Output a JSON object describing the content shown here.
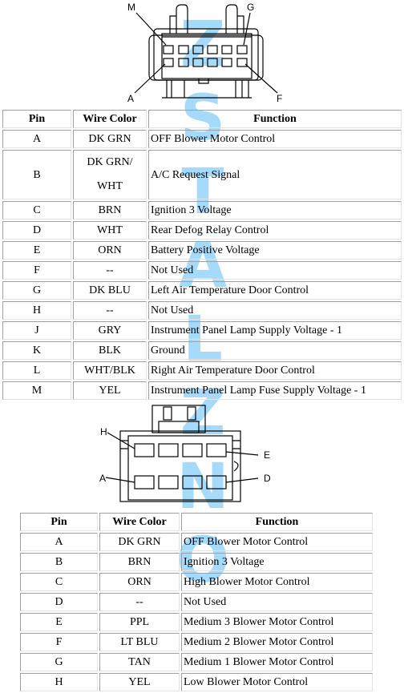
{
  "connector1": {
    "labels": {
      "top_left": "M",
      "top_right": "G",
      "bottom_left": "A",
      "bottom_right": "F"
    },
    "columns": [
      "Pin",
      "Wire Color",
      "Function"
    ],
    "rows": [
      {
        "pin": "A",
        "wire_color": "DK GRN",
        "function": "OFF Blower Motor Control"
      },
      {
        "pin": "B",
        "wire_color_line1": "DK GRN/",
        "wire_color_line2": "WHT",
        "function": "A/C Request Signal"
      },
      {
        "pin": "C",
        "wire_color": "BRN",
        "function": "Ignition 3 Voltage"
      },
      {
        "pin": "D",
        "wire_color": "WHT",
        "function": "Rear Defog Relay Control"
      },
      {
        "pin": "E",
        "wire_color": "ORN",
        "function": "Battery Positive Voltage"
      },
      {
        "pin": "F",
        "wire_color": "--",
        "function": "Not Used"
      },
      {
        "pin": "G",
        "wire_color": "DK BLU",
        "function": "Left Air Temperature Door Control"
      },
      {
        "pin": "H",
        "wire_color": "--",
        "function": "Not Used"
      },
      {
        "pin": "J",
        "wire_color": "GRY",
        "function": "Instrument Panel Lamp Supply Voltage - 1"
      },
      {
        "pin": "K",
        "wire_color": "BLK",
        "function": "Ground"
      },
      {
        "pin": "L",
        "wire_color": "WHT/BLK",
        "function": "Right Air Temperature Door Control"
      },
      {
        "pin": "M",
        "wire_color": "YEL",
        "function": "Instrument Panel Lamp Fuse Supply Voltage - 1"
      }
    ]
  },
  "connector2": {
    "labels": {
      "top_left": "H",
      "top_right": "E",
      "bottom_left": "A",
      "bottom_right": "D"
    },
    "columns": [
      "Pin",
      "Wire Color",
      "Function"
    ],
    "rows": [
      {
        "pin": "A",
        "wire_color": "DK GRN",
        "function": "OFF Blower Motor Control"
      },
      {
        "pin": "B",
        "wire_color": "BRN",
        "function": "Ignition 3 Voltage"
      },
      {
        "pin": "C",
        "wire_color": "ORN",
        "function": "High Blower Motor Control"
      },
      {
        "pin": "D",
        "wire_color": "--",
        "function": "Not Used"
      },
      {
        "pin": "E",
        "wire_color": "PPL",
        "function": "Medium 3 Blower Motor Control"
      },
      {
        "pin": "F",
        "wire_color": "LT BLU",
        "function": "Medium 2 Blower Motor Control"
      },
      {
        "pin": "G",
        "wire_color": "TAN",
        "function": "Medium 1 Blower Motor Control"
      },
      {
        "pin": "H",
        "wire_color": "YEL",
        "function": "Low Blower Motor Control"
      }
    ]
  },
  "watermark": {
    "letters": [
      "Z",
      "S",
      "T",
      "A",
      "L",
      "Z",
      "N",
      "O"
    ],
    "color": "#39aef5"
  }
}
